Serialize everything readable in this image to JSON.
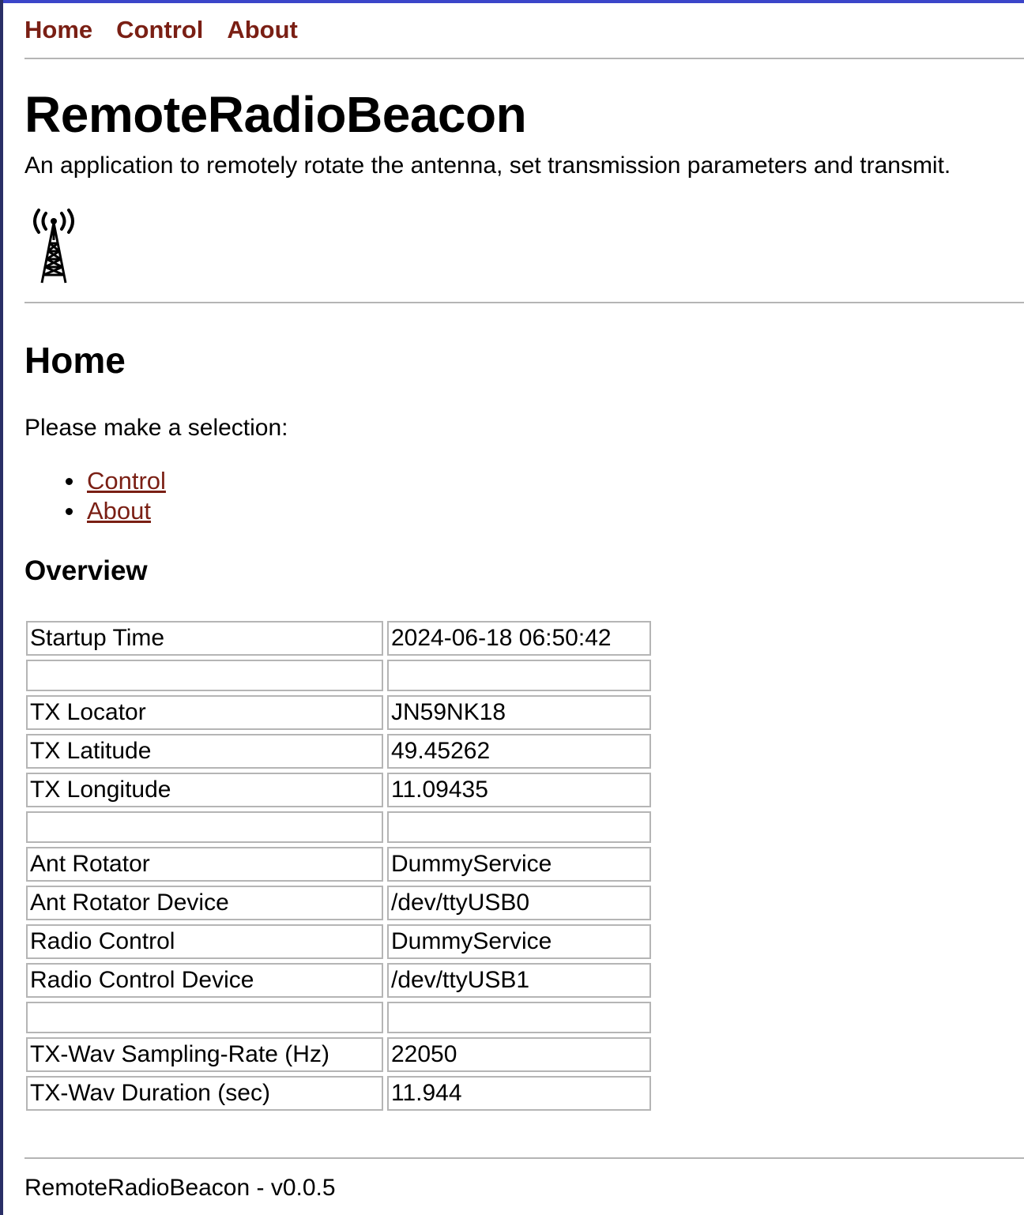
{
  "nav": {
    "home": "Home",
    "control": "Control",
    "about": "About"
  },
  "header": {
    "title": "RemoteRadioBeacon",
    "subtitle": "An application to remotely rotate the antenna, set transmission parameters and transmit.",
    "logo_icon": "radio-tower-icon"
  },
  "main": {
    "heading": "Home",
    "prompt": "Please make a selection:",
    "links": [
      "Control",
      "About"
    ],
    "overview_heading": "Overview",
    "table": [
      [
        "Startup Time",
        "2024-06-18 06:50:42"
      ],
      [
        "",
        ""
      ],
      [
        "TX Locator",
        "JN59NK18"
      ],
      [
        "TX Latitude",
        "49.45262"
      ],
      [
        "TX Longitude",
        "11.09435"
      ],
      [
        "",
        ""
      ],
      [
        "Ant Rotator",
        "DummyService"
      ],
      [
        "Ant Rotator Device",
        "/dev/ttyUSB0"
      ],
      [
        "Radio Control",
        "DummyService"
      ],
      [
        "Radio Control Device",
        "/dev/ttyUSB1"
      ],
      [
        "",
        ""
      ],
      [
        "TX-Wav Sampling-Rate (Hz)",
        "22050"
      ],
      [
        "TX-Wav Duration (sec)",
        "11.944"
      ]
    ]
  },
  "footer": {
    "text": "RemoteRadioBeacon - v0.0.5"
  },
  "colors": {
    "link": "#7a1f14",
    "rule": "#b5b5b5",
    "frame_top": "#3b45c9"
  }
}
